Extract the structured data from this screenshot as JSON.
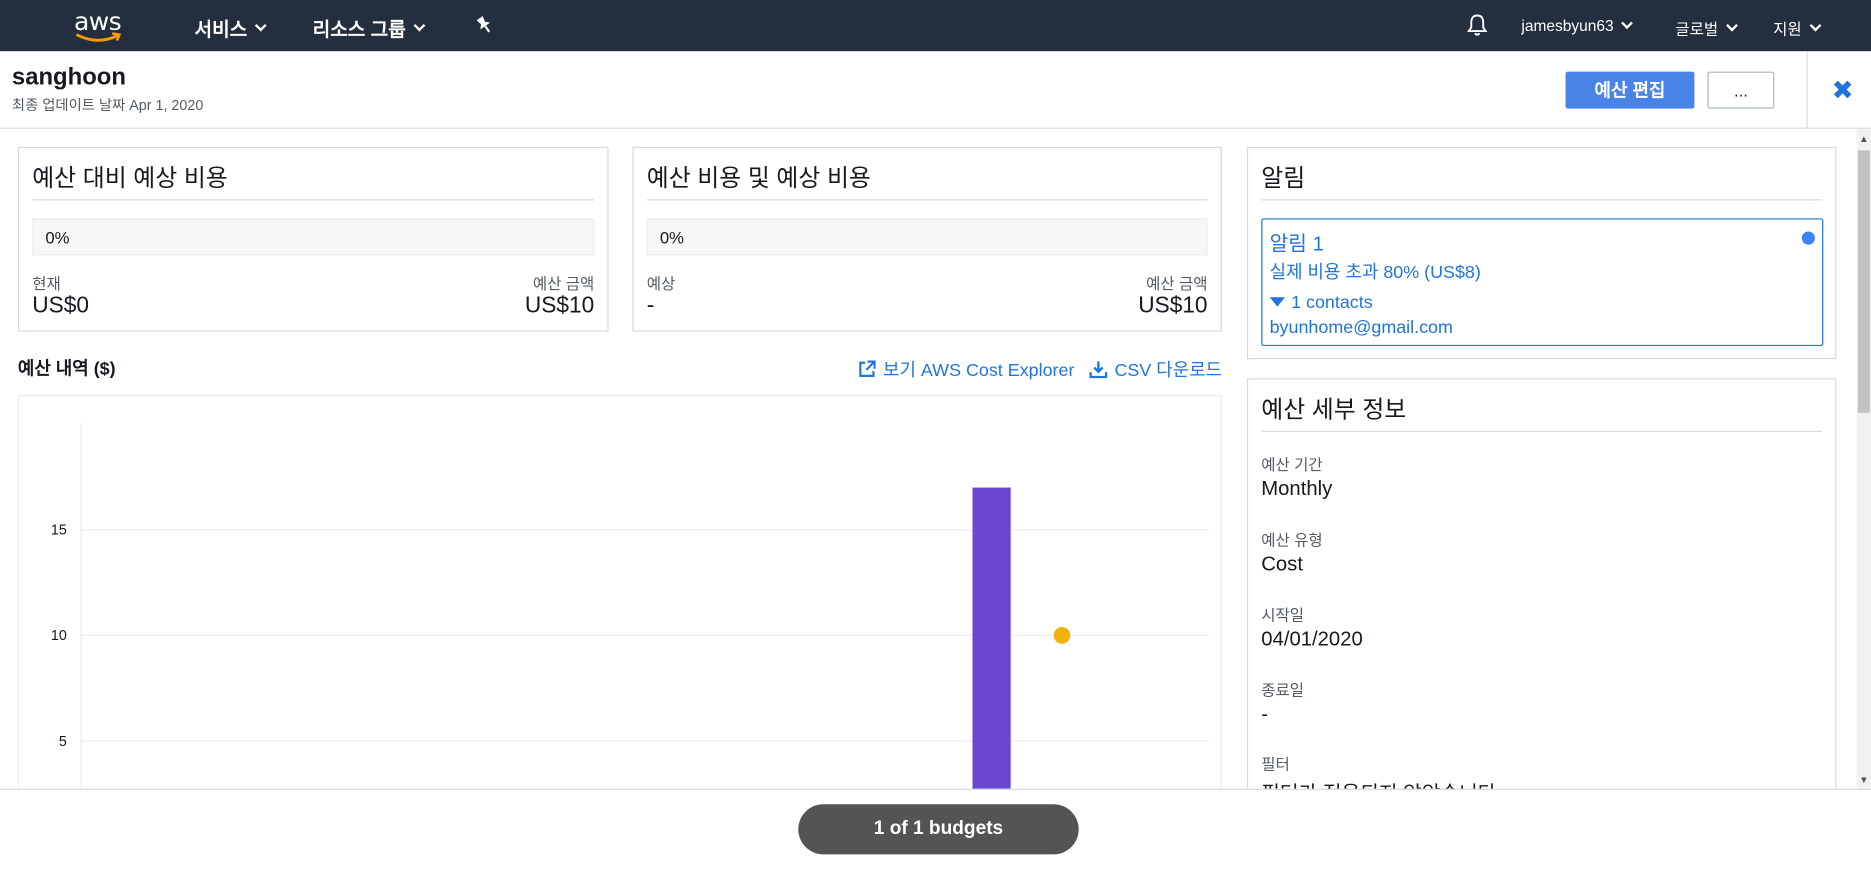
{
  "nav": {
    "logo_text": "aws",
    "services": "서비스",
    "resource_groups": "리소스 그룹",
    "user": "jamesbyun63",
    "region": "글로벌",
    "support": "지원"
  },
  "header": {
    "title": "sanghoon",
    "subtitle": "최종 업데이트 날짜 Apr 1, 2020",
    "edit_button": "예산 편집",
    "more_button": "...",
    "close": "✖"
  },
  "cards": {
    "forecast_vs_budget": {
      "title": "예산 대비 예상 비용",
      "percent": "0%",
      "left_label": "현재",
      "left_value": "US$0",
      "right_label": "예산 금액",
      "right_value": "US$10"
    },
    "budget_vs_forecast": {
      "title": "예산 비용 및 예상 비용",
      "percent": "0%",
      "left_label": "예상",
      "left_value": "-",
      "right_label": "예산 금액",
      "right_value": "US$10"
    }
  },
  "history": {
    "title": "예산 내역 ($)",
    "link_explorer": "보기 AWS Cost Explorer",
    "link_csv": "CSV 다운로드"
  },
  "chart_data": {
    "type": "bar",
    "ylim": [
      0,
      20
    ],
    "y_ticks": [
      "5",
      "10",
      "15"
    ],
    "series": [
      {
        "kind": "bar",
        "values": [
          17
        ],
        "color": "#6b47d1"
      },
      {
        "kind": "point",
        "values": [
          10
        ],
        "color": "#f2b10a"
      }
    ],
    "grid": true
  },
  "alerts": {
    "title": "알림",
    "items": [
      {
        "name": "알림 1",
        "condition": "실제 비용 초과 80% (US$8)",
        "contacts": "1 contacts",
        "email": "byunhome@gmail.com"
      }
    ]
  },
  "details": {
    "title": "예산 세부 정보",
    "rows": [
      {
        "label": "예산 기간",
        "value": "Monthly"
      },
      {
        "label": "예산 유형",
        "value": "Cost"
      },
      {
        "label": "시작일",
        "value": "04/01/2020"
      },
      {
        "label": "종료일",
        "value": "-"
      },
      {
        "label": "필터",
        "value": "필터가 적용되지 않았습니다"
      }
    ]
  },
  "footer": {
    "pager": "1 of 1 budgets"
  }
}
